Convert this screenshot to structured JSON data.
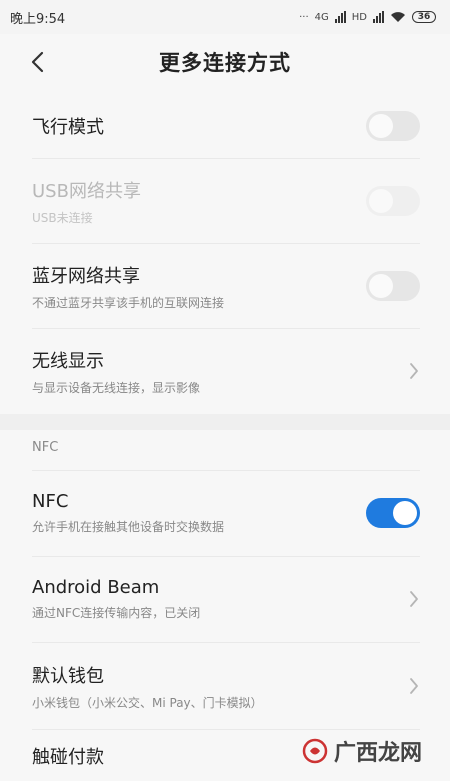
{
  "status_bar": {
    "time": "晚上9:54",
    "network1": "4G",
    "network2": "HD",
    "battery": "36"
  },
  "header": {
    "title": "更多连接方式"
  },
  "rows": {
    "airplane": {
      "title": "飞行模式"
    },
    "usb": {
      "title": "USB网络共享",
      "subtitle": "USB未连接"
    },
    "bluetooth": {
      "title": "蓝牙网络共享",
      "subtitle": "不通过蓝牙共享该手机的互联网连接"
    },
    "wireless_display": {
      "title": "无线显示",
      "subtitle": "与显示设备无线连接，显示影像"
    },
    "nfc": {
      "title": "NFC",
      "subtitle": "允许手机在接触其他设备时交换数据"
    },
    "android_beam": {
      "title": "Android Beam",
      "subtitle": "通过NFC连接传输内容，已关闭"
    },
    "wallet": {
      "title": "默认钱包",
      "subtitle": "小米钱包（小米公交、Mi Pay、门卡模拟）"
    },
    "tap_pay": {
      "title": "触碰付款"
    }
  },
  "section": {
    "nfc_header": "NFC"
  },
  "watermark": {
    "text": "广西龙网"
  },
  "colors": {
    "accent": "#1f7bdf",
    "background": "#f7f7f7"
  }
}
